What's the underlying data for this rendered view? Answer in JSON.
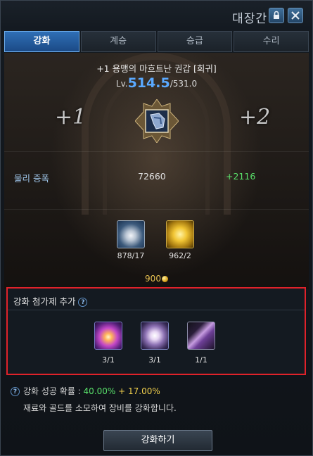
{
  "window": {
    "title": "대장간"
  },
  "tabs": [
    {
      "label": "강화",
      "active": true
    },
    {
      "label": "계승",
      "active": false
    },
    {
      "label": "승급",
      "active": false
    },
    {
      "label": "수리",
      "active": false
    }
  ],
  "item": {
    "name": "+1 용맹의 마흐트난 권갑 [희귀]",
    "level_prefix": "Lv.",
    "level_current": "514.5",
    "level_max": "/531.0",
    "icon": "gauntlet-icon"
  },
  "enhance": {
    "current": "+1",
    "next": "+2"
  },
  "stat": {
    "label": "물리 증폭",
    "value": "72660",
    "bonus": "+2116"
  },
  "materials": [
    {
      "icon": "crystal-ore-icon",
      "count": "878/17"
    },
    {
      "icon": "gold-shard-icon",
      "count": "962/2"
    }
  ],
  "gold_cost": "900",
  "additives": {
    "title": "강화 첨가제 추가",
    "items": [
      {
        "icon": "fire-orb-icon",
        "count": "3/1"
      },
      {
        "icon": "purple-stone-icon",
        "count": "3/1"
      },
      {
        "icon": "violet-crystal-icon",
        "count": "1/1"
      }
    ]
  },
  "probability": {
    "label": "강화 성공 확률 : ",
    "base": "40.00%",
    "bonus": " + 17.00%"
  },
  "description": "재료와 골드를 소모하여 장비를 강화합니다.",
  "action_button": "강화하기",
  "colors": {
    "accent": "#2f6fb6",
    "level": "#5aa9ff",
    "positive": "#59e06a",
    "gold": "#e6c050",
    "highlight_border": "#e0222a"
  }
}
